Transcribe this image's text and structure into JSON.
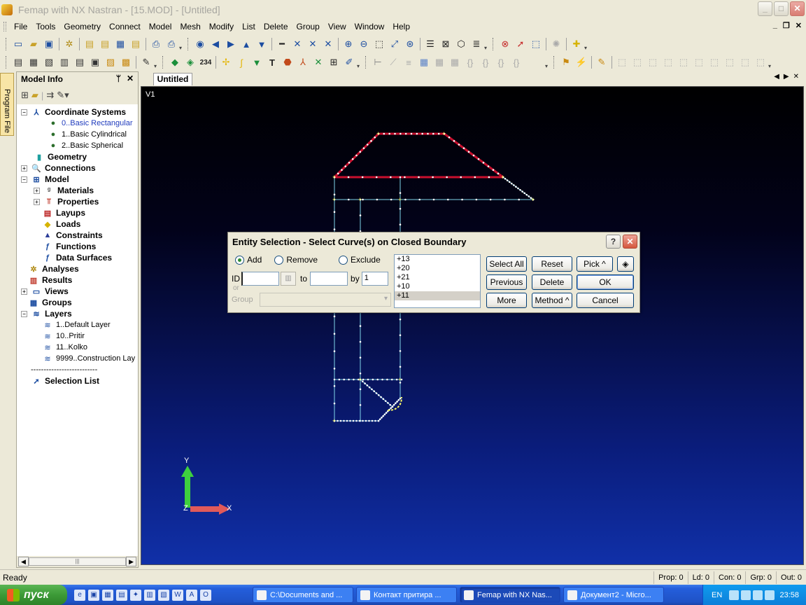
{
  "window": {
    "title": "Femap with NX Nastran - [15.MOD] - [Untitled]",
    "buttons": {
      "minimize": "_",
      "maximize": "□",
      "close": "✕"
    }
  },
  "menubar": {
    "items": [
      {
        "label": "File"
      },
      {
        "label": "Tools"
      },
      {
        "label": "Geometry"
      },
      {
        "label": "Connect"
      },
      {
        "label": "Model"
      },
      {
        "label": "Mesh"
      },
      {
        "label": "Modify"
      },
      {
        "label": "List"
      },
      {
        "label": "Delete"
      },
      {
        "label": "Group"
      },
      {
        "label": "View"
      },
      {
        "label": "Window"
      },
      {
        "label": "Help"
      }
    ]
  },
  "model_info": {
    "title": "Model Info",
    "side_tab": "Program File",
    "tree": [
      {
        "label": "Coordinate Systems",
        "bold": true,
        "icon": "coordinate-axes-icon",
        "expander": "−"
      },
      {
        "label": "0..Basic Rectangular",
        "icon": "globe-icon",
        "selected": true
      },
      {
        "label": "1..Basic Cylindrical",
        "icon": "globe-icon"
      },
      {
        "label": "2..Basic Spherical",
        "icon": "globe-icon"
      },
      {
        "label": "Geometry",
        "bold": true,
        "icon": "cylinder-icon"
      },
      {
        "label": "Connections",
        "bold": true,
        "icon": "magnifier-icon",
        "expander": "+"
      },
      {
        "label": "Model",
        "bold": true,
        "icon": "grid-icon",
        "expander": "−"
      },
      {
        "label": "Materials",
        "bold": true,
        "icon": "materials-icon",
        "expander": "+"
      },
      {
        "label": "Properties",
        "bold": true,
        "icon": "beam-icon",
        "expander": "+"
      },
      {
        "label": "Layups",
        "bold": true,
        "icon": "layers-stack-icon"
      },
      {
        "label": "Loads",
        "bold": true,
        "icon": "load-icon"
      },
      {
        "label": "Constraints",
        "bold": true,
        "icon": "constraint-icon"
      },
      {
        "label": "Functions",
        "bold": true,
        "icon": "function-icon"
      },
      {
        "label": "Data Surfaces",
        "bold": true,
        "icon": "data-surface-icon"
      },
      {
        "label": "Analyses",
        "bold": true,
        "icon": "analysis-icon"
      },
      {
        "label": "Results",
        "bold": true,
        "icon": "results-icon"
      },
      {
        "label": "Views",
        "bold": true,
        "icon": "views-icon",
        "expander": "+"
      },
      {
        "label": "Groups",
        "bold": true,
        "icon": "groups-icon"
      },
      {
        "label": "Layers",
        "bold": true,
        "icon": "layers-icon",
        "expander": "−"
      },
      {
        "label": "1..Default Layer",
        "icon": "layer-icon"
      },
      {
        "label": "10..Pritir",
        "icon": "layer-icon"
      },
      {
        "label": "11..Kolko",
        "icon": "layer-icon"
      },
      {
        "label": "9999..Construction Lay",
        "icon": "layer-icon"
      },
      {
        "label": "--------------------------",
        "icon": ""
      },
      {
        "label": "Selection List",
        "bold": true,
        "icon": "cursor-icon"
      }
    ]
  },
  "document_tab": "Untitled",
  "viewport": {
    "view_label": "V1",
    "axis_labels": {
      "y": "Y",
      "x": "X",
      "z": "Z"
    },
    "colors": {
      "selected_curve": "#c8102e",
      "curve": "#7fd4e8",
      "point": "#ffff66"
    }
  },
  "dialog": {
    "title": "Entity Selection - Select Curve(s) on Closed Boundary",
    "radios": [
      {
        "label": "Add",
        "checked": true
      },
      {
        "label": "Remove",
        "checked": false
      },
      {
        "label": "Exclude",
        "checked": false
      }
    ],
    "id_label": "ID",
    "id_value": "",
    "to_label": "to",
    "to_value": "",
    "by_label": "by",
    "by_value": "1",
    "or_label": "or",
    "group_label": "Group",
    "list": [
      "+13",
      "+20",
      "+21",
      "+10",
      "+11"
    ],
    "buttons": {
      "select_all": "Select All",
      "reset": "Reset",
      "pick": "Pick ^",
      "previous": "Previous",
      "delete": "Delete",
      "ok": "OK",
      "more": "More",
      "method": "Method ^",
      "cancel": "Cancel"
    }
  },
  "statusbar": {
    "ready": "Ready",
    "cells": [
      "Prop: 0",
      "Ld: 0",
      "Con: 0",
      "Grp: 0",
      "Out: 0"
    ]
  },
  "taskbar": {
    "start": "пуск",
    "tasks": [
      {
        "label": "C:\\Documents and ...",
        "active": false
      },
      {
        "label": "Контакт притира ...",
        "active": false
      },
      {
        "label": "Femap with NX Nas...",
        "active": true
      },
      {
        "label": "Документ2 - Micro...",
        "active": false
      }
    ],
    "language": "EN",
    "clock": "23:58"
  }
}
